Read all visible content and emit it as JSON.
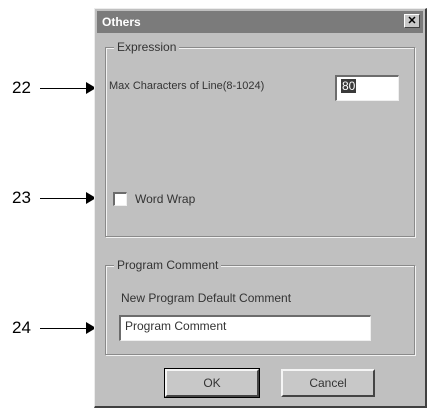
{
  "callouts": [
    "22",
    "23",
    "24"
  ],
  "dialog": {
    "title": "Others",
    "close_glyph": "✕",
    "expression_group": {
      "label": "Expression",
      "max_chars_label": "Max Characters of Line(8-1024)",
      "max_chars_value": "80",
      "word_wrap_label": "Word Wrap",
      "word_wrap_checked": false
    },
    "comment_group": {
      "label": "Program Comment",
      "default_label": "New Program Default Comment",
      "default_value": "Program Comment"
    },
    "ok_label": "OK",
    "cancel_label": "Cancel"
  }
}
